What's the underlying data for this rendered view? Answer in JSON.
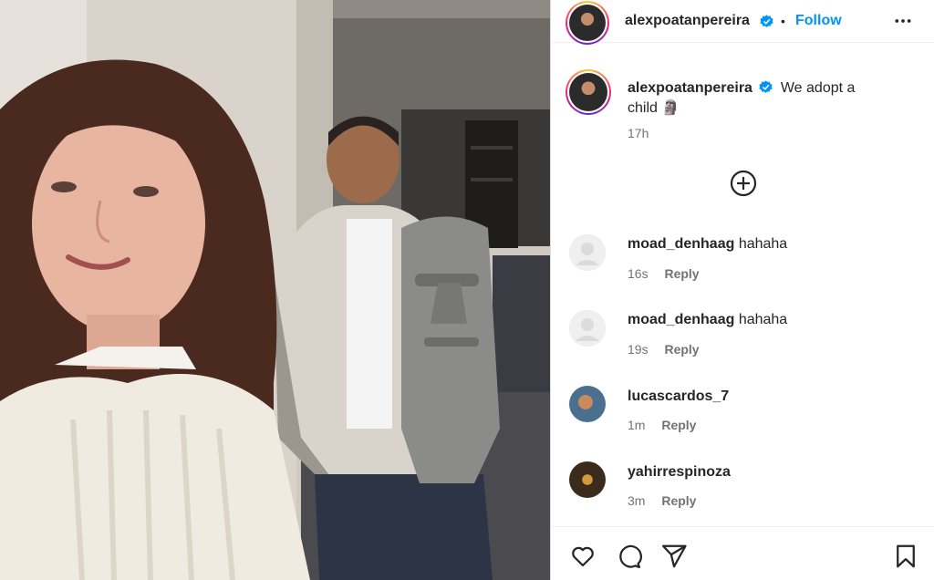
{
  "post": {
    "author": "alexpoatanpereira",
    "follow_label": "Follow",
    "separator": "•",
    "caption_username": "alexpoatanpereira",
    "caption_line1": "We adopt a",
    "caption_line2": "child 🗿",
    "caption_time": "17h"
  },
  "comments": [
    {
      "username": "moad_denhaag",
      "text": "hahaha",
      "time": "16s",
      "reply": "Reply",
      "avatar": "default"
    },
    {
      "username": "moad_denhaag",
      "text": "hahaha",
      "time": "19s",
      "reply": "Reply",
      "avatar": "default"
    },
    {
      "username": "lucascardos_7",
      "text": "",
      "time": "1m",
      "reply": "Reply",
      "avatar": "photo"
    },
    {
      "username": "yahirrespinoza",
      "text": "",
      "time": "3m",
      "reply": "Reply",
      "avatar": "photo"
    }
  ],
  "icons": {
    "verified": "verified-badge-icon",
    "more": "more-options-icon",
    "load_more": "plus-circle-icon",
    "like": "heart-icon",
    "comment": "comment-icon",
    "share": "send-icon",
    "save": "bookmark-icon"
  },
  "colors": {
    "link": "#0095f6",
    "verified": "#0095f6",
    "muted": "#737373"
  }
}
